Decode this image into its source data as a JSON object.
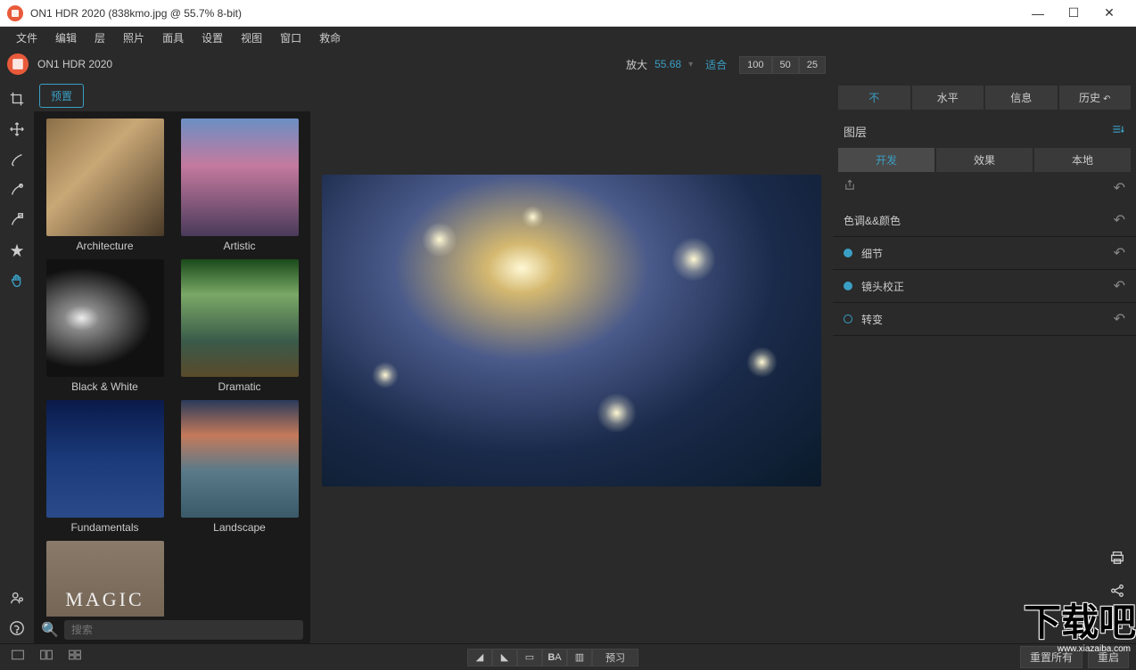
{
  "titlebar": {
    "text": "ON1 HDR 2020 (838kmo.jpg @ 55.7% 8-bit)"
  },
  "menu": [
    "文件",
    "编辑",
    "层",
    "照片",
    "面具",
    "设置",
    "视图",
    "窗口",
    "救命"
  ],
  "subheader": {
    "app": "ON1 HDR 2020",
    "zoom_label": "放大",
    "zoom_value": "55.68",
    "fit": "适合",
    "levels": [
      "100",
      "50",
      "25"
    ]
  },
  "preset": {
    "tab": "预置",
    "items": [
      {
        "label": "Architecture",
        "cls": "thumb-arch"
      },
      {
        "label": "Artistic",
        "cls": "thumb-art"
      },
      {
        "label": "Black & White",
        "cls": "thumb-bw"
      },
      {
        "label": "Dramatic",
        "cls": "thumb-dram"
      },
      {
        "label": "Fundamentals",
        "cls": "thumb-fund"
      },
      {
        "label": "Landscape",
        "cls": "thumb-land"
      },
      {
        "label": "MAGIC",
        "cls": "thumb-magic",
        "text": "MAGIC"
      }
    ],
    "search_placeholder": "搜索"
  },
  "right": {
    "tabs": [
      "不",
      "水平",
      "信息",
      "历史"
    ],
    "layers": "图层",
    "modes": [
      "开发",
      "效果",
      "本地"
    ],
    "sections": [
      {
        "label": "色调&&颜色",
        "on": null
      },
      {
        "label": "细节",
        "on": true
      },
      {
        "label": "镜头校正",
        "on": true
      },
      {
        "label": "转变",
        "on": false
      }
    ]
  },
  "bottom": {
    "preview": "预习",
    "reset_all": "重置所有",
    "restart": "重启"
  },
  "watermark": "下载吧",
  "watermark_url": "www.xiazaiba.com"
}
